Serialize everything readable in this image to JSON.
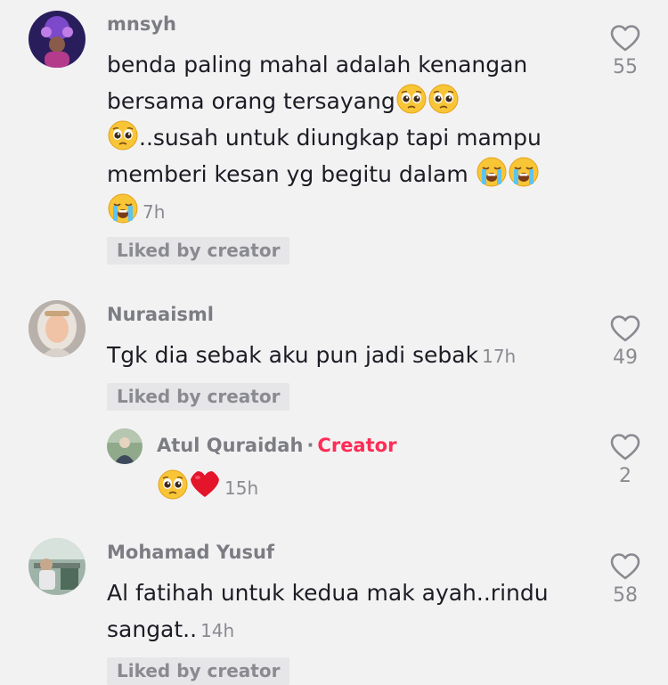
{
  "comments": [
    {
      "username": "mnsyh",
      "text_lines": [
        "benda paling mahal adalah kenangan",
        "bersama orang tersayang",
        "..susah untuk diungkap tapi mampu",
        "memberi kesan yg begitu dalam "
      ],
      "time": "7h",
      "liked_label": "Liked by creator",
      "likes": "55",
      "icon": "heart-outline-icon"
    },
    {
      "username": "Nuraaisml",
      "text": "Tgk dia sebak aku pun jadi sebak",
      "time": "17h",
      "liked_label": "Liked by creator",
      "likes": "49",
      "icon": "heart-outline-icon"
    },
    {
      "username": "Atul Quraidah",
      "separator": "·",
      "badge": "Creator",
      "time": "15h",
      "likes": "2",
      "icon": "heart-outline-icon"
    },
    {
      "username": "Mohamad Yusuf",
      "text_lines": [
        "Al fatihah untuk kedua mak ayah..rindu",
        "sangat.."
      ],
      "time": "14h",
      "liked_label": "Liked by creator",
      "likes": "58",
      "icon": "heart-outline-icon"
    }
  ],
  "colors": {
    "background": "#f3f2f3",
    "creator_badge": "#fe2c55",
    "muted": "#8a8b91"
  }
}
